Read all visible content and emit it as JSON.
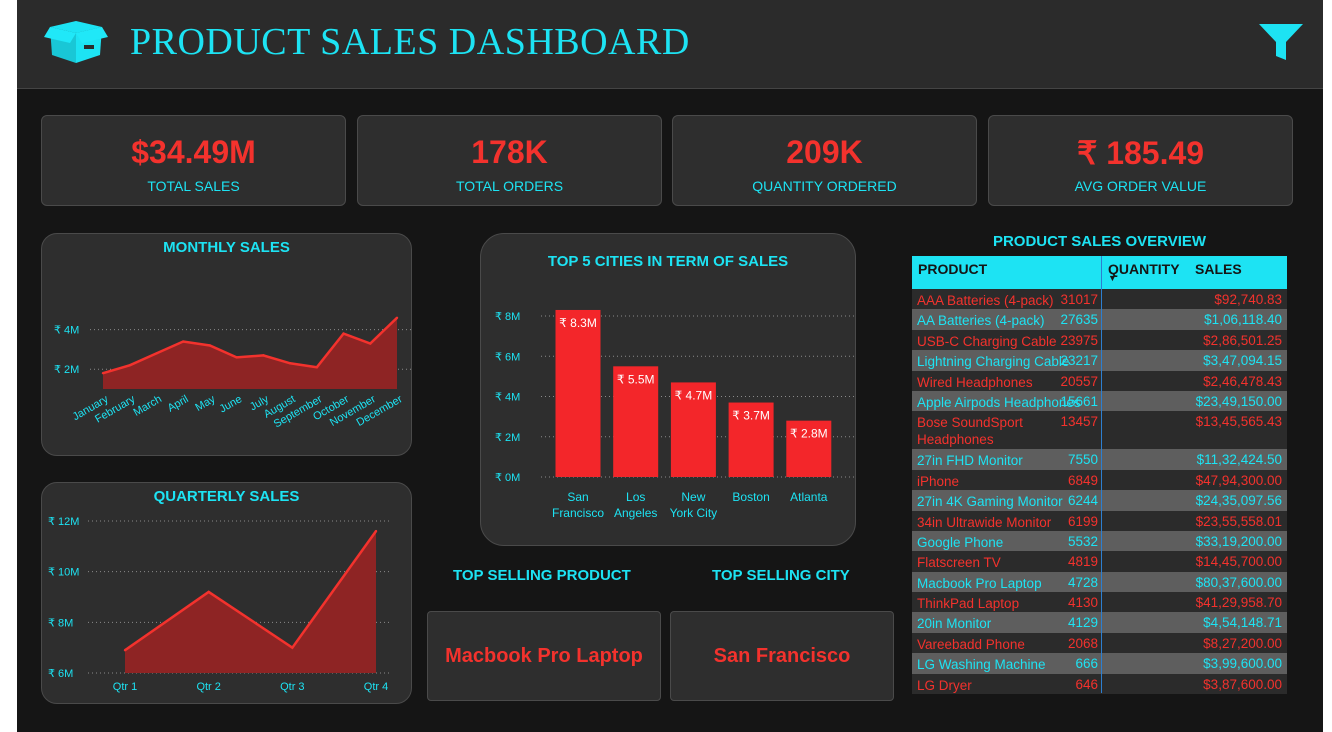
{
  "header": {
    "title": "PRODUCT SALES DASHBOARD"
  },
  "kpis": [
    {
      "value": "$34.49M",
      "label": "TOTAL SALES"
    },
    {
      "value": "178K",
      "label": "TOTAL ORDERS"
    },
    {
      "value": "209K",
      "label": "QUANTITY ORDERED"
    },
    {
      "value": "₹ 185.49",
      "label": "AVG ORDER VALUE"
    }
  ],
  "colors": {
    "accent": "#1de3f3",
    "highlight": "#f3322d",
    "background": "#151515",
    "panel": "#2e2e2e"
  },
  "chart_data": [
    {
      "type": "area",
      "title": "MONTHLY SALES",
      "categories": [
        "January",
        "February",
        "March",
        "April",
        "May",
        "June",
        "July",
        "August",
        "September",
        "October",
        "November",
        "December"
      ],
      "values": [
        1.8,
        2.2,
        2.8,
        3.4,
        3.2,
        2.6,
        2.7,
        2.3,
        2.1,
        3.8,
        3.3,
        4.6
      ],
      "yticks": [
        "₹ 2M",
        "₹ 4M"
      ],
      "ytick_values": [
        2,
        4
      ],
      "ylim": [
        1,
        5.5
      ],
      "unit": "M"
    },
    {
      "type": "bar",
      "title": "TOP 5 CITIES IN TERM OF SALES",
      "categories": [
        "San Francisco",
        "Los Angeles",
        "New York City",
        "Boston",
        "Atlanta"
      ],
      "category_lines": [
        [
          "San",
          "Francisco"
        ],
        [
          "Los",
          "Angeles"
        ],
        [
          "New",
          "York City"
        ],
        [
          "Boston"
        ],
        [
          "Atlanta"
        ]
      ],
      "values": [
        8.3,
        5.5,
        4.7,
        3.7,
        2.8
      ],
      "data_labels": [
        "₹ 8.3M",
        "₹ 5.5M",
        "₹ 4.7M",
        "₹ 3.7M",
        "₹ 2.8M"
      ],
      "yticks": [
        "₹ 0M",
        "₹ 2M",
        "₹ 4M",
        "₹ 6M",
        "₹ 8M"
      ],
      "ytick_values": [
        0,
        2,
        4,
        6,
        8
      ],
      "ylim": [
        0,
        8
      ]
    },
    {
      "type": "area",
      "title": "QUARTERLY SALES",
      "categories": [
        "Qtr 1",
        "Qtr 2",
        "Qtr 3",
        "Qtr 4"
      ],
      "values": [
        6.9,
        9.2,
        7.0,
        11.6
      ],
      "yticks": [
        "₹ 6M",
        "₹ 8M",
        "₹ 10M",
        "₹ 12M"
      ],
      "ytick_values": [
        6,
        8,
        10,
        12
      ],
      "ylim": [
        6,
        12
      ]
    }
  ],
  "top_selling": {
    "product_title": "TOP SELLING PRODUCT",
    "product_value": "Macbook Pro Laptop",
    "city_title": "TOP SELLING CITY",
    "city_value": "San Francisco"
  },
  "table": {
    "title": "PRODUCT SALES OVERVIEW",
    "columns": [
      "PRODUCT",
      "QUANTITY",
      "SALES"
    ],
    "sort_indicator": "▼",
    "rows": [
      {
        "product": "AAA Batteries (4-pack)",
        "quantity": "31017",
        "sales": "$92,740.83"
      },
      {
        "product": "AA Batteries (4-pack)",
        "quantity": "27635",
        "sales": "$1,06,118.40"
      },
      {
        "product": "USB-C Charging Cable",
        "quantity": "23975",
        "sales": "$2,86,501.25"
      },
      {
        "product": "Lightning Charging Cable",
        "quantity": "23217",
        "sales": "$3,47,094.15"
      },
      {
        "product": "Wired Headphones",
        "quantity": "20557",
        "sales": "$2,46,478.43"
      },
      {
        "product": "Apple Airpods Headphones",
        "quantity": "15661",
        "sales": "$23,49,150.00"
      },
      {
        "product": "Bose SoundSport Headphones",
        "quantity": "13457",
        "sales": "$13,45,565.43"
      },
      {
        "product": "27in FHD Monitor",
        "quantity": "7550",
        "sales": "$11,32,424.50"
      },
      {
        "product": "iPhone",
        "quantity": "6849",
        "sales": "$47,94,300.00"
      },
      {
        "product": "27in 4K Gaming Monitor",
        "quantity": "6244",
        "sales": "$24,35,097.56"
      },
      {
        "product": "34in Ultrawide Monitor",
        "quantity": "6199",
        "sales": "$23,55,558.01"
      },
      {
        "product": "Google Phone",
        "quantity": "5532",
        "sales": "$33,19,200.00"
      },
      {
        "product": "Flatscreen TV",
        "quantity": "4819",
        "sales": "$14,45,700.00"
      },
      {
        "product": "Macbook Pro Laptop",
        "quantity": "4728",
        "sales": "$80,37,600.00"
      },
      {
        "product": "ThinkPad Laptop",
        "quantity": "4130",
        "sales": "$41,29,958.70"
      },
      {
        "product": "20in Monitor",
        "quantity": "4129",
        "sales": "$4,54,148.71"
      },
      {
        "product": "Vareebadd Phone",
        "quantity": "2068",
        "sales": "$8,27,200.00"
      },
      {
        "product": "LG Washing Machine",
        "quantity": "666",
        "sales": "$3,99,600.00"
      },
      {
        "product": "LG Dryer",
        "quantity": "646",
        "sales": "$3,87,600.00"
      }
    ]
  }
}
